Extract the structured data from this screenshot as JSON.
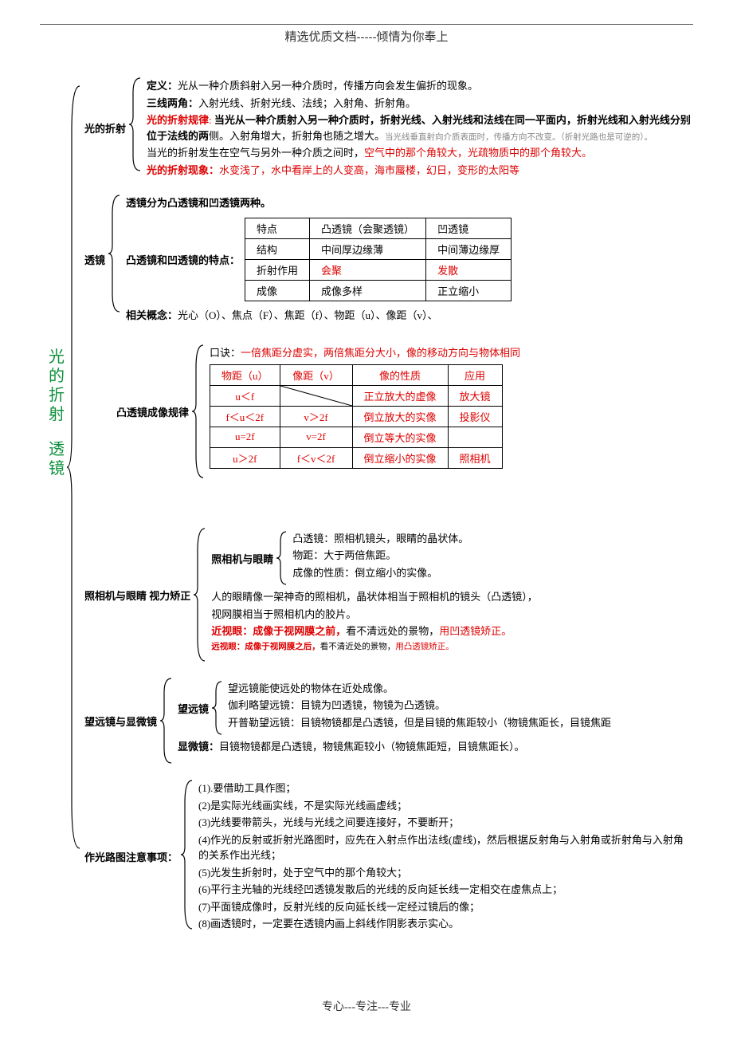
{
  "header": "精选优质文档-----倾情为你奉上",
  "footer": "专心---专注---专业",
  "main_title_1": "光的折射",
  "main_title_2": "透镜",
  "sec1": {
    "label": "光的折射",
    "p1a": "定义：",
    "p1b": "光从一种介质斜射入另一种介质时，传播方向会发生偏折的现象。",
    "p2a": "三线两角：",
    "p2b": "入射光线、折射光线、法线；入射角、折射角。",
    "p3a": "光的折射规律",
    "p3b": "当光从一种介质射入另一种介质时，折射光线、入射光线和法线在同一平面内，折射光线和入射光线分别位于法线的两",
    "p3c": "侧。入射角增大，折射角也随之增大。",
    "p3d": "当光线垂直射向介质表面时，传播方向不改变。（折射光路也是可逆的）。",
    "p4a": "当光的折射发生在空气与另外一种介质之间时，",
    "p4b": "空气中的那个角较大，光疏物质中的那个角较大。",
    "p5a": "光的折射现象：",
    "p5b": "水变浅了，水中看岸上的人变高，海市蜃楼，幻日，变形的太阳等"
  },
  "sec2": {
    "label": "透镜",
    "p1": "透镜分为凸透镜和凹透镜两种。",
    "p2": "凸透镜和凹透镜的特点：",
    "table": {
      "h1": "特点",
      "h2": "凸透镜（会聚透镜）",
      "h3": "凹透镜",
      "r1c1": "结构",
      "r1c2": "中间厚边缘薄",
      "r1c3": "中间薄边缘厚",
      "r2c1": "折射作用",
      "r2c2": "会聚",
      "r2c3": "发散",
      "r3c1": "成像",
      "r3c2": "成像多样",
      "r3c3": "正立缩小"
    },
    "p3a": "相关概念：",
    "p3b": "光心（O）、焦点（F）、焦距（f）、物距（u）、像距（v）、"
  },
  "sec3": {
    "label": "凸透镜成像规律",
    "p1a": "口诀：",
    "p1b": "一倍焦距分虚实，两倍焦距分大小，像的移动方向与物体相同",
    "table": {
      "h1": "物距（u）",
      "h2": "像距（v）",
      "h3": "像的性质",
      "h4": "应用",
      "r": [
        {
          "c1": "u＜f",
          "c2": "",
          "c3": "正立放大的虚像",
          "c4": "放大镜",
          "diag": true
        },
        {
          "c1": "f＜u＜2f",
          "c2": "v＞2f",
          "c3": "倒立放大的实像",
          "c4": "投影仪"
        },
        {
          "c1": "u=2f",
          "c2": "v=2f",
          "c3": "倒立等大的实像",
          "c4": ""
        },
        {
          "c1": "u＞2f",
          "c2": "f＜v＜2f",
          "c3": "倒立缩小的实像",
          "c4": "照相机"
        }
      ]
    }
  },
  "sec4": {
    "label": "照相机与眼睛 视力矫正",
    "sub1_label": "照相机与眼睛",
    "sub1_p1": "凸透镜：照相机镜头，眼睛的晶状体。",
    "sub1_p2": "物距：大于两倍焦距。",
    "sub1_p3": "成像的性质：倒立缩小的实像。",
    "p2": "人的眼睛像一架神奇的照相机，晶状体相当于照相机的镜头（凸透镜），",
    "p3": "视网膜相当于照相机内的胶片。",
    "p4a": "近视眼：成像于视网膜之前，",
    "p4b": "看不清远处的景物，",
    "p4c": "用凹透镜矫正。",
    "p5a": "远视眼：成像于视网膜之后，",
    "p5b": "看不清近处的景物，",
    "p5c": "用凸透镜矫正。"
  },
  "sec5": {
    "label": "望远镜与显微镜",
    "sub1_label": "望远镜",
    "sub1_p1": "望远镜能使远处的物体在近处成像。",
    "sub1_p2": "伽利略望远镜：目镜为凹透镜，物镜为凸透镜。",
    "sub1_p3": "开普勒望远镜：目镜物镜都是凸透镜，但是目镜的焦距较小（物镜焦距长，目镜焦距",
    "sub2_label": "显微镜：",
    "sub2_p1": "目镜物镜都是凸透镜，物镜焦距较小（物镜焦距短，目镜焦距长）。"
  },
  "sec6": {
    "label": "作光路图注意事项：",
    "items": [
      "(1).要借助工具作图；",
      "(2)是实际光线画实线，不是实际光线画虚线；",
      "(3)光线要带箭头，光线与光线之间要连接好，不要断开；",
      "(4)作光的反射或折射光路图时，应先在入射点作出法线(虚线)，然后根据反射角与入射角或折射角与入射角的关系作出光线；",
      "(5)光发生折射时，处于空气中的那个角较大；",
      "(6)平行主光轴的光线经凹透镜发散后的光线的反向延长线一定相交在虚焦点上；",
      "(7)平面镜成像时，反射光线的反向延长线一定经过镜后的像；",
      "(8)画透镜时，一定要在透镜内画上斜线作阴影表示实心。"
    ]
  }
}
